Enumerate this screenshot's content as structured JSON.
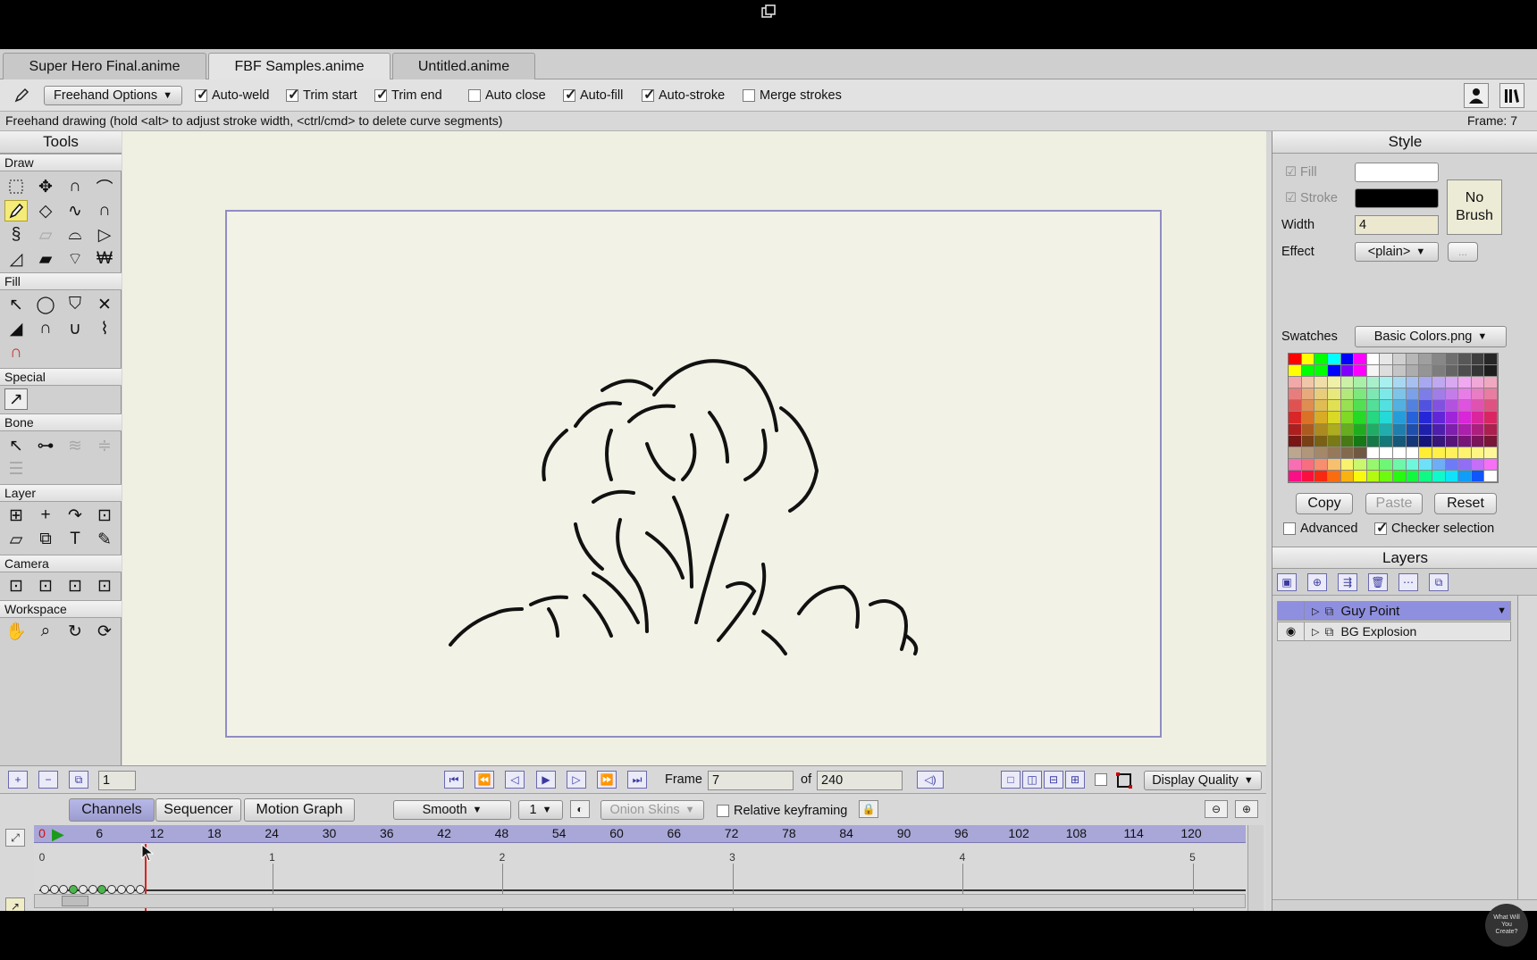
{
  "tabs": [
    {
      "label": "Super Hero Final.anime",
      "active": false
    },
    {
      "label": "FBF Samples.anime",
      "active": true
    },
    {
      "label": "Untitled.anime",
      "active": false
    }
  ],
  "options": {
    "freehand_dropdown": "Freehand Options",
    "checkboxes": [
      {
        "label": "Auto-weld",
        "checked": true
      },
      {
        "label": "Trim start",
        "checked": true
      },
      {
        "label": "Trim end",
        "checked": true
      },
      {
        "label": "Auto close",
        "checked": false
      },
      {
        "label": "Auto-fill",
        "checked": true
      },
      {
        "label": "Auto-stroke",
        "checked": true
      },
      {
        "label": "Merge strokes",
        "checked": false
      }
    ]
  },
  "status": {
    "hint": "Freehand drawing (hold <alt> to adjust stroke width, <ctrl/cmd> to delete curve segments)",
    "frame_readout": "Frame: 7"
  },
  "tools": {
    "title": "Tools",
    "sections": [
      "Draw",
      "Fill",
      "Special",
      "Bone",
      "Layer",
      "Camera",
      "Workspace"
    ]
  },
  "style": {
    "title": "Style",
    "fill_label": "Fill",
    "stroke_label": "Stroke",
    "width_label": "Width",
    "width_value": "4",
    "effect_label": "Effect",
    "effect_value": "<plain>",
    "effect_more": "...",
    "brush_label": "No Brush",
    "swatches_label": "Swatches",
    "swatches_value": "Basic Colors.png",
    "copy": "Copy",
    "paste": "Paste",
    "reset": "Reset",
    "advanced": "Advanced",
    "checker": "Checker selection",
    "fill_color": "#ffffff",
    "stroke_color": "#000000"
  },
  "layers": {
    "title": "Layers",
    "items": [
      {
        "name": "Guy Point",
        "selected": true
      },
      {
        "name": "BG Explosion",
        "selected": false
      }
    ]
  },
  "navigation": {
    "frame_step": "1",
    "frame_label": "Frame",
    "frame_value": "7",
    "of_label": "of",
    "total_frames": "240",
    "display_quality": "Display Quality"
  },
  "timeline": {
    "tabs": [
      "Channels",
      "Sequencer",
      "Motion Graph"
    ],
    "interp": "Smooth",
    "interp_step": "1",
    "onion": "Onion Skins",
    "relative": "Relative keyframing",
    "ruler_marks": [
      "0",
      "6",
      "12",
      "18",
      "24",
      "30",
      "36",
      "42",
      "48",
      "54",
      "60",
      "66",
      "72",
      "78",
      "84",
      "90",
      "96",
      "102",
      "108",
      "114",
      "120"
    ],
    "seconds": [
      "0",
      "1",
      "2",
      "3",
      "4",
      "5"
    ]
  },
  "watermark": "What Will You Create?"
}
